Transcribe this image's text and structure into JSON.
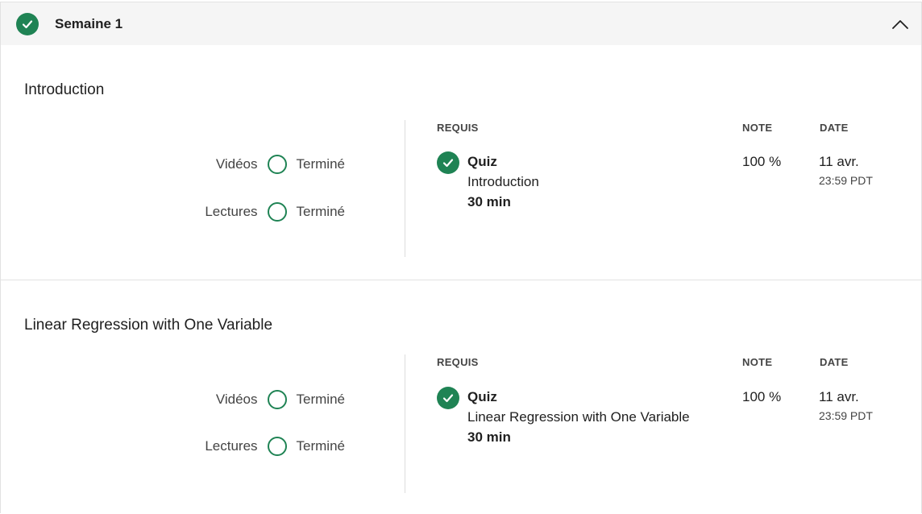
{
  "week": {
    "title": "Semaine 1",
    "status_icon": "check-circle-icon",
    "toggle_icon": "chevron-up-icon"
  },
  "lessons": [
    {
      "title": "Introduction",
      "progress": [
        {
          "label": "Vidéos",
          "status": "Terminé"
        },
        {
          "label": "Lectures",
          "status": "Terminé"
        }
      ],
      "headers": {
        "required": "REQUIS",
        "grade": "NOTE",
        "date": "DATE"
      },
      "item": {
        "type": "Quiz",
        "name": "Introduction",
        "duration": "30 min",
        "grade": "100 %",
        "date": "11 avr.",
        "time": "23:59 PDT"
      }
    },
    {
      "title": "Linear Regression with One Variable",
      "progress": [
        {
          "label": "Vidéos",
          "status": "Terminé"
        },
        {
          "label": "Lectures",
          "status": "Terminé"
        }
      ],
      "headers": {
        "required": "REQUIS",
        "grade": "NOTE",
        "date": "DATE"
      },
      "item": {
        "type": "Quiz",
        "name": "Linear Regression with One Variable",
        "duration": "30 min",
        "grade": "100 %",
        "date": "11 avr.",
        "time": "23:59 PDT"
      }
    }
  ],
  "colors": {
    "accent": "#1f8354",
    "header_bg": "#f5f5f5",
    "border": "#e2e2e2"
  }
}
